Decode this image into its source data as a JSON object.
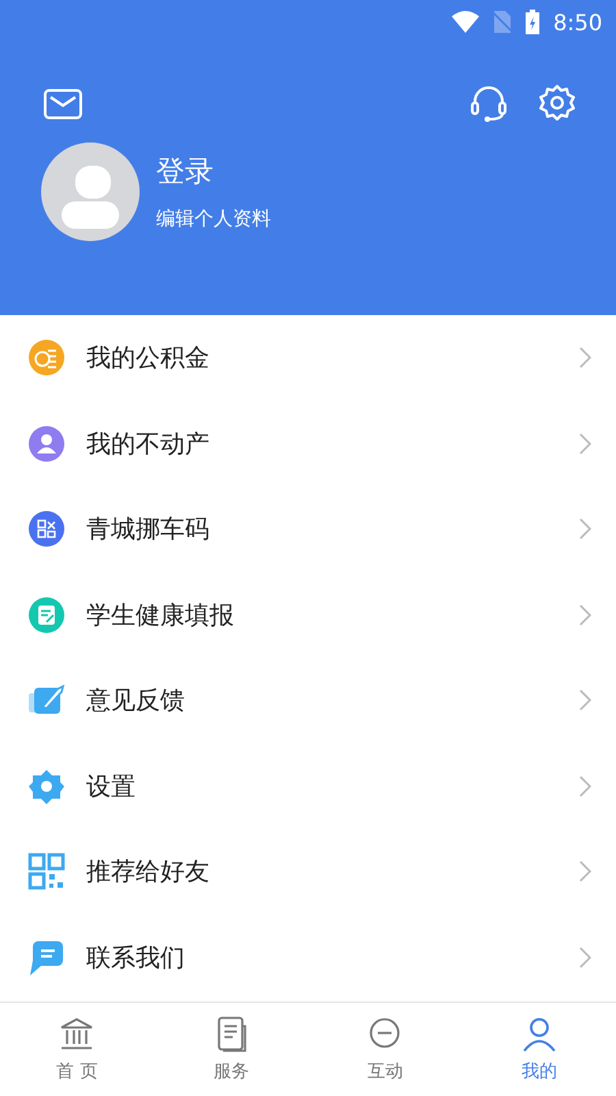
{
  "status_bar": {
    "time": "8:50"
  },
  "profile": {
    "name": "登录",
    "subtitle": "编辑个人资料"
  },
  "menu": [
    {
      "label": "我的公积金",
      "kind": "coin",
      "color": "#f5a623"
    },
    {
      "label": "我的不动产",
      "kind": "person",
      "color": "#8e7cf0"
    },
    {
      "label": "青城挪车码",
      "kind": "code",
      "color": "#4a72f0"
    },
    {
      "label": "学生健康填报",
      "kind": "form",
      "color": "#14c8b0"
    },
    {
      "label": "意见反馈",
      "kind": "edit",
      "color": "#3da9f0"
    },
    {
      "label": "设置",
      "kind": "gear",
      "color": "#3da9f0"
    },
    {
      "label": "推荐给好友",
      "kind": "qr",
      "color": "#3da9f0"
    },
    {
      "label": "联系我们",
      "kind": "chat",
      "color": "#3da9f0"
    }
  ],
  "tabs": [
    {
      "label": "首 页",
      "kind": "bank",
      "selected": false
    },
    {
      "label": "服务",
      "kind": "doc",
      "selected": false
    },
    {
      "label": "互动",
      "kind": "bubble",
      "selected": false
    },
    {
      "label": "我的",
      "kind": "user",
      "selected": true
    }
  ]
}
